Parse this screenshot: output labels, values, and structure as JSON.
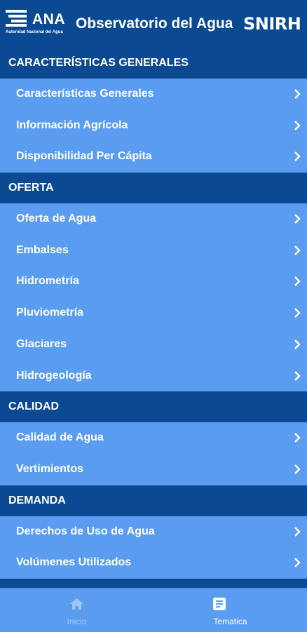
{
  "header": {
    "logo_text": "ANA",
    "logo_subtext": "Autoridad Nacional del Agua",
    "title": "Observatorio del Agua",
    "right_logo": "SNIRH"
  },
  "sections": [
    {
      "title": "CARACTERÍSTICAS GENERALES",
      "items": [
        "Características Generales",
        "Información Agrícola",
        "Disponibilidad Per Cápita"
      ]
    },
    {
      "title": "OFERTA",
      "items": [
        "Oferta de Agua",
        "Embalses",
        "Hidrometría",
        "Pluviometría",
        "Glaciares",
        "Hidrogeología"
      ]
    },
    {
      "title": "CALIDAD",
      "items": [
        "Calidad de Agua",
        "Vertimientos"
      ]
    },
    {
      "title": "DEMANDA",
      "items": [
        "Derechos de Uso de Agua",
        "Volúmenes Utilizados"
      ]
    }
  ],
  "bottom_nav": {
    "tabs": [
      {
        "label": "Inicio",
        "icon": "home-icon",
        "active": false
      },
      {
        "label": "Tematica",
        "icon": "document-icon",
        "active": true
      }
    ]
  },
  "colors": {
    "header_bg": "#0b4a93",
    "item_bg": "#5a9df0",
    "text": "#ffffff",
    "inactive_tab": "#9fc4f2"
  }
}
